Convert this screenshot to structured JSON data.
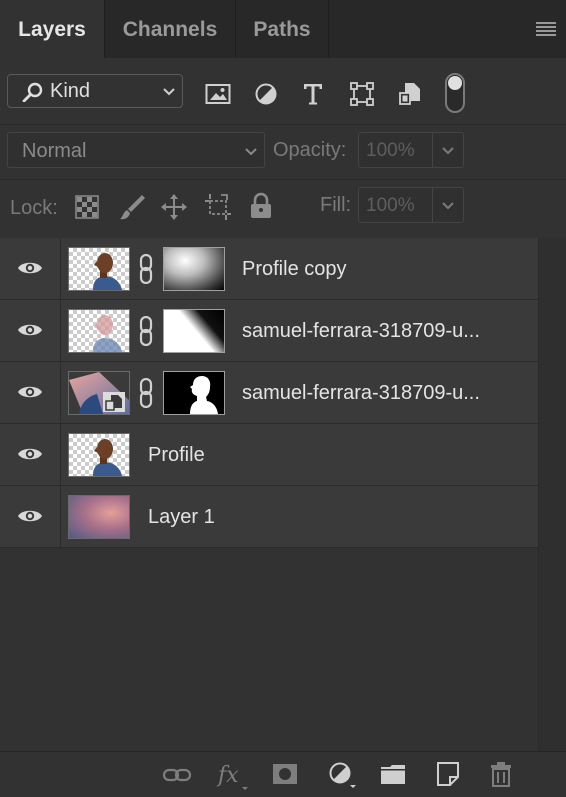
{
  "tabs": [
    {
      "label": "Layers",
      "active": true
    },
    {
      "label": "Channels",
      "active": false
    },
    {
      "label": "Paths",
      "active": false
    }
  ],
  "filter": {
    "kind_label": "Kind",
    "icons": [
      "image-filter-icon",
      "adjustment-filter-icon",
      "type-filter-icon",
      "shape-filter-icon",
      "smart-object-filter-icon"
    ]
  },
  "blend": {
    "mode": "Normal",
    "opacity_label": "Opacity:",
    "opacity_value": "100%"
  },
  "lock": {
    "label": "Lock:",
    "fill_label": "Fill:",
    "fill_value": "100%"
  },
  "layers": [
    {
      "name": "Profile copy",
      "visible": true,
      "has_mask": true
    },
    {
      "name": "samuel-ferrara-318709-u...",
      "visible": true,
      "has_mask": true
    },
    {
      "name": "samuel-ferrara-318709-u...",
      "visible": true,
      "has_mask": true,
      "smart_object": true
    },
    {
      "name": "Profile",
      "visible": true,
      "has_mask": false
    },
    {
      "name": "Layer 1",
      "visible": true,
      "has_mask": false
    }
  ],
  "colors": {
    "panel_bg": "#323232",
    "layer_row_bg": "#3a3a3a",
    "tab_bar_bg": "#282828"
  }
}
